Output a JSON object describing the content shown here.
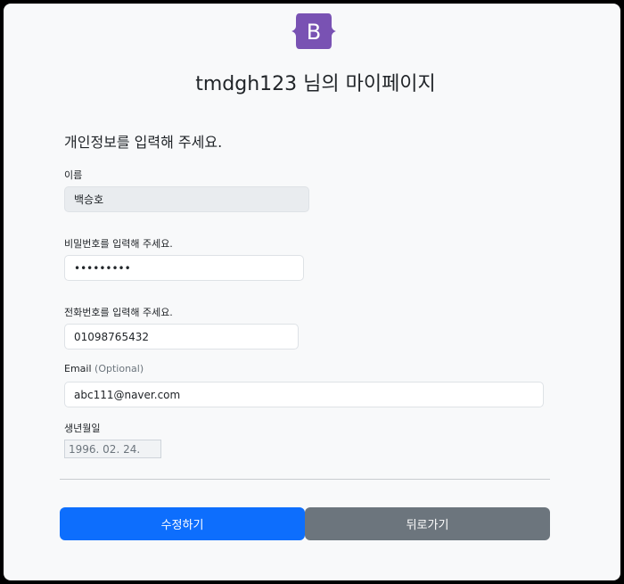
{
  "header": {
    "logo_letter": "B",
    "logo_color": "#7952b3",
    "page_title": "tmdgh123 님의 마이페이지"
  },
  "form": {
    "section_title": "개인정보를 입력해 주세요.",
    "name": {
      "label": "이름",
      "value": "백승호"
    },
    "password": {
      "label": "비밀번호를 입력해 주세요.",
      "value": "123456789"
    },
    "phone": {
      "label": "전화번호를 입력해 주세요.",
      "value": "01098765432"
    },
    "email": {
      "label": "Email",
      "optional": "(Optional)",
      "value": "abc111@naver.com"
    },
    "birthdate": {
      "label": "생년월일",
      "value": "1996. 02. 24."
    }
  },
  "actions": {
    "submit_label": "수정하기",
    "back_label": "뒤로가기",
    "primary_color": "#0d6efd",
    "secondary_color": "#6c757d"
  }
}
